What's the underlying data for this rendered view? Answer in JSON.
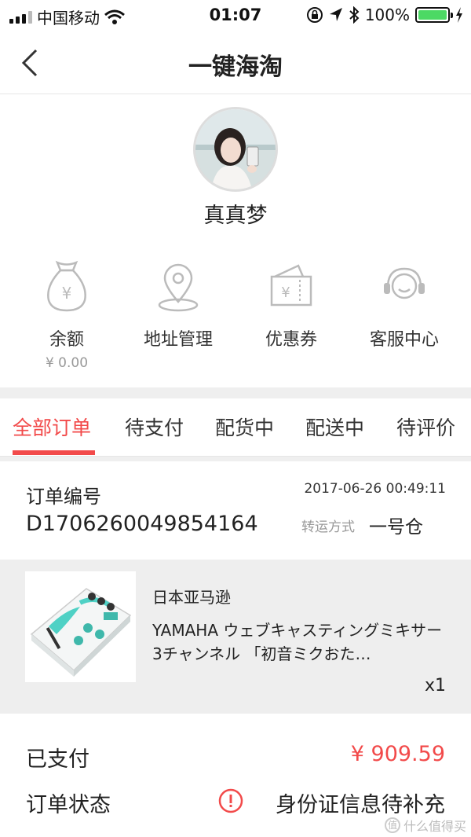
{
  "status_bar": {
    "carrier": "中国移动",
    "time": "01:07",
    "battery": "100%",
    "icons": [
      "signal-icon",
      "wifi-icon",
      "lock-rotation-icon",
      "location-icon",
      "bluetooth-icon",
      "battery-icon",
      "charging-icon"
    ]
  },
  "nav": {
    "title": "一键海淘",
    "back_icon": "chevron-left-icon"
  },
  "profile": {
    "username": "真真梦"
  },
  "quick_actions": [
    {
      "label": "余额",
      "sub": "¥ 0.00",
      "icon": "money-bag-icon"
    },
    {
      "label": "地址管理",
      "icon": "location-pin-icon"
    },
    {
      "label": "优惠券",
      "icon": "coupon-icon"
    },
    {
      "label": "客服中心",
      "icon": "headset-icon"
    }
  ],
  "tabs": [
    "全部订单",
    "待支付",
    "配货中",
    "配送中",
    "待评价"
  ],
  "order": {
    "number_label": "订单编号",
    "number": "D1706260049854164",
    "time": "2017-06-26 00:49:11",
    "shipping_label": "转运方式",
    "shipping_value": "一号仓",
    "product": {
      "store": "日本亚马逊",
      "name": "YAMAHA ウェブキャスティングミキサー 3チャンネル 「初音ミクおた…",
      "quantity": "x1"
    },
    "paid_label": "已支付",
    "paid_value": "¥ 909.59",
    "status_label": "订单状态",
    "status_value": "身份证信息待补充"
  },
  "watermark": {
    "text": "什么值得买",
    "logo": "值"
  },
  "colors": {
    "accent": "#f24a4a",
    "battery": "#4cd964"
  }
}
